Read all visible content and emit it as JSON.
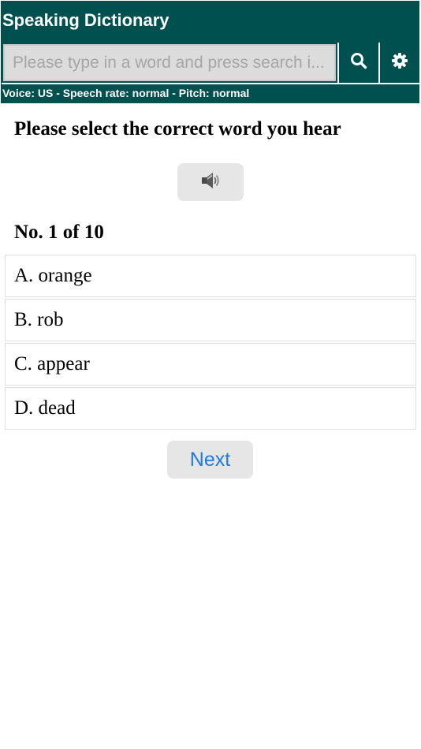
{
  "app": {
    "title": "Speaking Dictionary"
  },
  "search": {
    "value": "",
    "placeholder": "Please type in a word and press search i..."
  },
  "toolbar": {
    "search_icon": "search-icon",
    "settings_icon": "gear-icon"
  },
  "status": {
    "text": "Voice: US - Speech rate: normal - Pitch: normal"
  },
  "quiz": {
    "instruction": "Please select the correct word you hear",
    "play_icon": "speaker-icon",
    "counter": "No. 1 of 10",
    "options": [
      {
        "label": "A. orange"
      },
      {
        "label": "B. rob"
      },
      {
        "label": "C. appear"
      },
      {
        "label": "D. dead"
      }
    ],
    "next_label": "Next"
  },
  "colors": {
    "header_bg": "#005050",
    "header_text": "#ffffff",
    "button_bg": "#e6e6e6",
    "link_blue": "#1f7ae0"
  }
}
